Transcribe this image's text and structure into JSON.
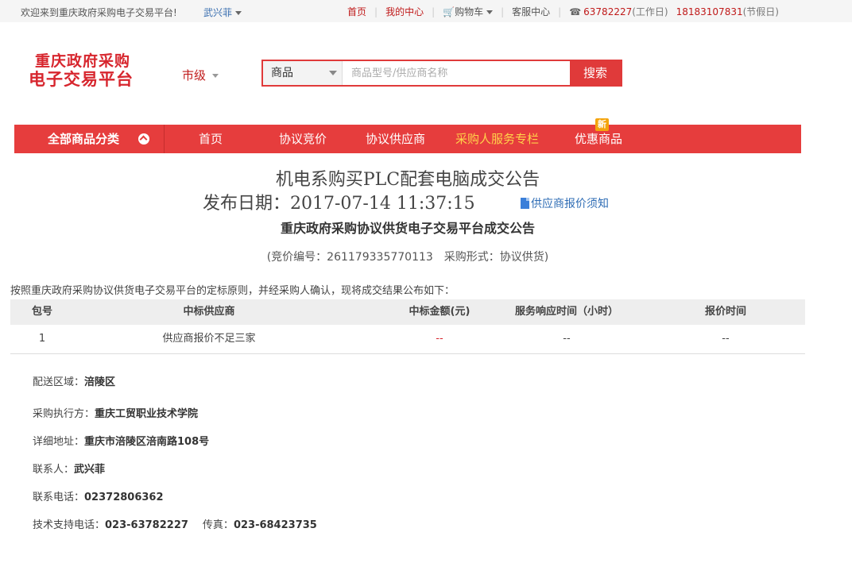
{
  "topbar": {
    "welcome": "欢迎来到重庆政府采购电子交易平台!",
    "user": "武兴菲",
    "home": "首页",
    "my_center": "我的中心",
    "cart": "购物车",
    "service": "客服中心",
    "phone_work": "63782227",
    "phone_work_label": "(工作日)",
    "phone_holiday": "18183107831",
    "phone_holiday_label": "(节假日)"
  },
  "header": {
    "logo_line1": "重庆政府采购",
    "logo_line2": "电子交易平台",
    "city": "市级",
    "search_category": "商品",
    "search_placeholder": "商品型号/供应商名称",
    "search_button": "搜索"
  },
  "nav": {
    "all_categories": "全部商品分类",
    "items": [
      "首页",
      "协议竞价",
      "协议供应商",
      "采购人服务专栏",
      "优惠商品"
    ],
    "new_badge": "新"
  },
  "announcement": {
    "title": "机电系购买PLC配套电脑成交公告",
    "date": "发布日期：2017-07-14 11:37:15",
    "notice_link": "供应商报价须知",
    "subtitle": "重庆政府采购协议供货电子交易平台成交公告",
    "bid_info": "(竞价编号：261179335770113　采购形式：协议供货)",
    "intro": "按照重庆政府采购协议供货电子交易平台的定标原则，并经采购人确认，现将成交结果公布如下：",
    "table": {
      "headers": [
        "包号",
        "中标供应商",
        "中标金额(元)",
        "服务响应时间（小时）",
        "报价时间"
      ],
      "rows": [
        [
          "1",
          "供应商报价不足三家",
          "--",
          "--",
          "--"
        ]
      ]
    },
    "details": {
      "region_label": "配送区域：",
      "region": "涪陵区",
      "executor_label": "采购执行方：",
      "executor": "重庆工贸职业技术学院",
      "address_label": "详细地址：",
      "address": "重庆市涪陵区涪南路108号",
      "contact_label": "联系人：",
      "contact": "武兴菲",
      "phone_label": "联系电话：",
      "phone": "02372806362",
      "tech_label": "技术支持电话：",
      "tech": "023-63782227",
      "fax_label": "传真：",
      "fax": "023-68423735"
    }
  }
}
